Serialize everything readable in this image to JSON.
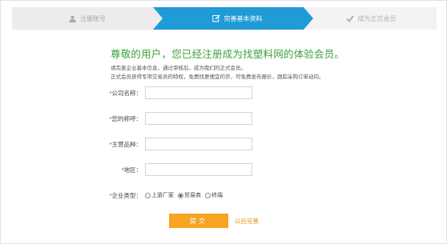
{
  "steps": [
    {
      "label": "注册账号",
      "icon": "user-icon",
      "state": "done"
    },
    {
      "label": "完善基本资料",
      "icon": "edit-icon",
      "state": "current"
    },
    {
      "label": "成为正式会员",
      "icon": "check-icon",
      "state": "todo"
    }
  ],
  "colors": {
    "step_active": "#1f9bd7",
    "heading": "#3ba13b",
    "required": "#d9262a",
    "button": "#f7a423",
    "link": "#e0961b"
  },
  "heading": "尊敬的用户，您已经注册成为找塑料网的体验会员。",
  "notes": [
    "请完善企业基本信息，通过审核后，成为我们的正式会员。",
    "正式会员获得专项交易员的特权，免费找更便宜的货，可免费发布报价，跟踪采购订单动向。"
  ],
  "form": {
    "required_mark": "*",
    "fields": [
      {
        "label": "公司名称：",
        "value": ""
      },
      {
        "label": "您的称呼：",
        "value": ""
      },
      {
        "label": "主营品种：",
        "value": ""
      },
      {
        "label": "地区：",
        "value": ""
      }
    ],
    "company_type": {
      "label": "企业类型：",
      "options": [
        "上游厂家",
        "贸易商",
        "终端"
      ],
      "selected": "贸易商"
    },
    "submit_label": "提交",
    "later_label": "以后完善"
  }
}
